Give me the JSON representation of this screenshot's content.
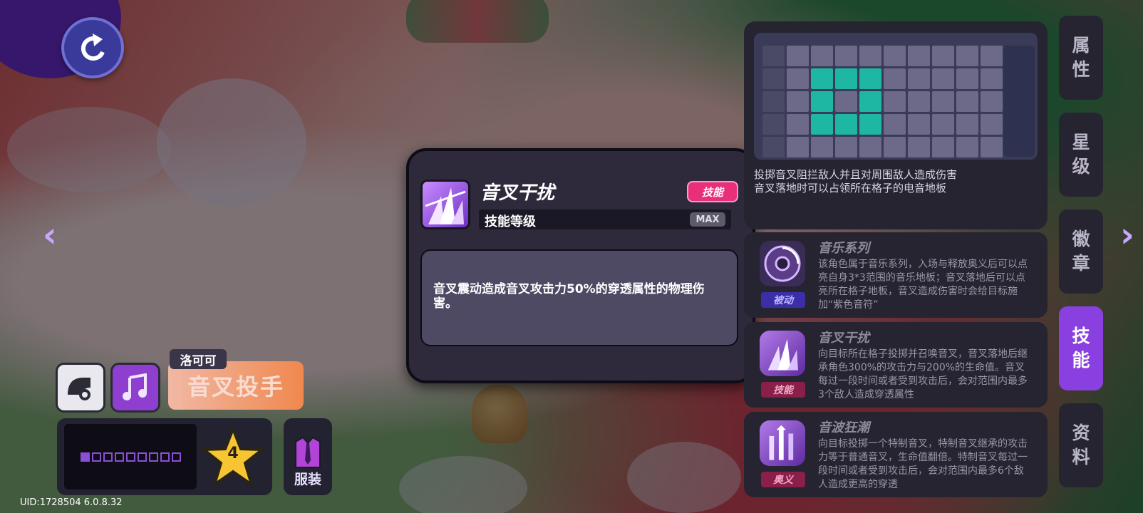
{
  "tabs": [
    {
      "label_1": "属",
      "label_2": "性",
      "active": false
    },
    {
      "label_1": "星",
      "label_2": "级",
      "active": false
    },
    {
      "label_1": "徽",
      "label_2": "章",
      "active": false
    },
    {
      "label_1": "技",
      "label_2": "能",
      "active": true
    },
    {
      "label_1": "资",
      "label_2": "料",
      "active": false
    }
  ],
  "character": {
    "name": "洛可可",
    "class": "音叉投手",
    "star_level": "4",
    "costume_label": "服装",
    "progress_total": 9,
    "progress_filled": 1
  },
  "uid_text": "UID:1728504 6.0.8.32",
  "popup": {
    "title": "音叉干扰",
    "badge": "技能",
    "level_label": "技能等级",
    "level_value": "MAX",
    "description": "音叉震动造成音叉攻击力50%的穿透属性的物理伤害。"
  },
  "grid_card": {
    "line1": "投掷音叉阻拦敌人并且对周围敌人造成伤害",
    "line2": "音叉落地时可以占领所在格子的电音地板"
  },
  "skills": [
    {
      "name": "音乐系列",
      "tag": "被动",
      "tag_color": "#3b2fa8",
      "icon": "disc-icon",
      "desc": "该角色属于音乐系列，入场与释放奥义后可以点亮自身3*3范围的音乐地板；音叉落地后可以点亮所在格子地板，音叉造成伤害时会给目标施加“紫色音符”"
    },
    {
      "name": "音叉干扰",
      "tag": "技能",
      "tag_color": "#8a1f4a",
      "icon": "tuning-fork-icon",
      "desc": "向目标所在格子投掷并召唤音叉，音叉落地后继承角色300%的攻击力与200%的生命值。音叉每过一段时间或者受到攻击后，会对范围内最多3个敌人造成穿透属性"
    },
    {
      "name": "音波狂潮",
      "tag": "奥义",
      "tag_color": "#8a1f4a",
      "icon": "sound-wave-icon",
      "desc": "向目标投掷一个特制音叉，特制音叉继承的攻击力等于普通音叉，生命值翻倍。特制音叉每过一段时间或者受到攻击后，会对范围内最多6个敌人造成更高的穿透"
    }
  ],
  "colors": {
    "accent_purple": "#8a3fe0",
    "badge_pink": "#ea2f7a",
    "highlight_cell": "#1eb7a3"
  }
}
